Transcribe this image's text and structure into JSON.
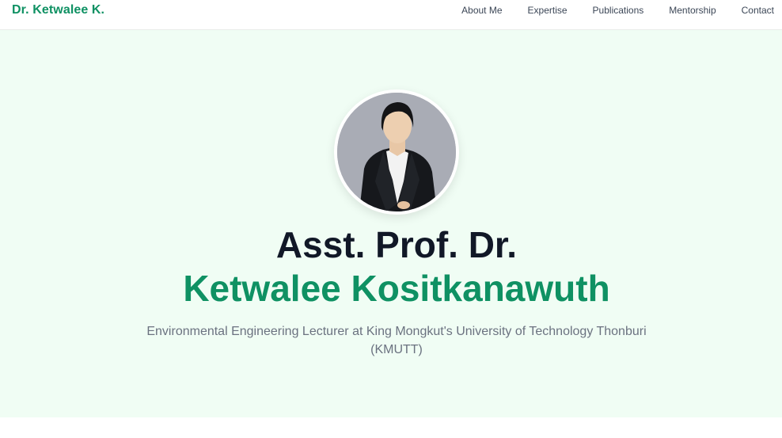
{
  "header": {
    "brand": "Dr. Ketwalee K.",
    "nav": [
      {
        "label": "About Me"
      },
      {
        "label": "Expertise"
      },
      {
        "label": "Publications"
      },
      {
        "label": "Mentorship"
      },
      {
        "label": "Contact"
      }
    ]
  },
  "hero": {
    "title_prefix": "Asst. Prof. Dr.",
    "name": "Ketwalee Kositkanawuth",
    "subtitle": "Environmental Engineering Lecturer at King Mongkut's University of Technology Thonburi (KMUTT)",
    "accent_color": "#0f9163",
    "background_color": "#f0fdf4"
  }
}
